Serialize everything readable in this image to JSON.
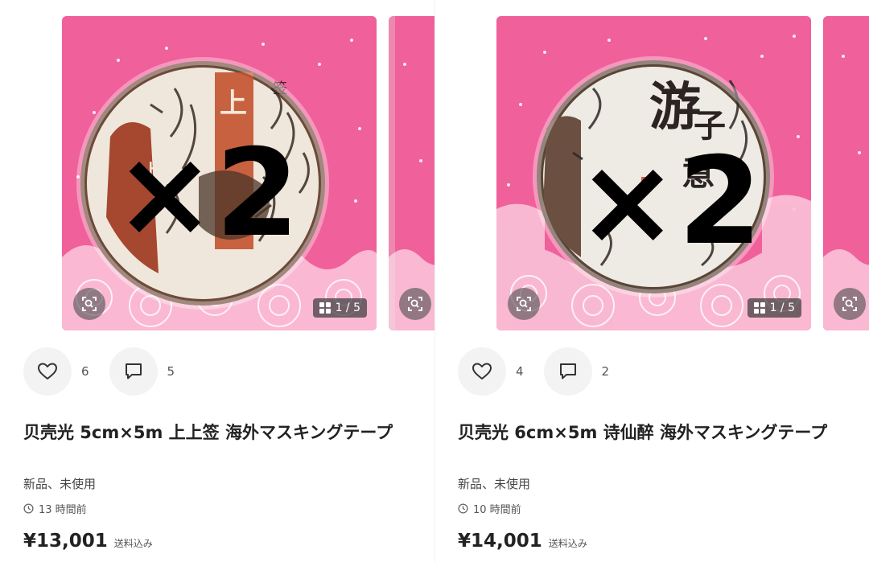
{
  "listings": [
    {
      "title": "贝壳光 5cm×5m 上上签 海外マスキングテープ",
      "condition": "新品、未使用",
      "posted": "13 時間前",
      "price": "¥13,001",
      "shipping": "送料込み",
      "likes": "6",
      "comments": "5",
      "image_counter": "1 / 5",
      "overlay_text": "×2",
      "tape_chars": [
        "上",
        "上",
        "签"
      ],
      "icons": [
        "heart-icon",
        "comment-icon",
        "clock-icon",
        "lens-search-icon",
        "grid-icon"
      ]
    },
    {
      "title": "贝壳光 6cm×5m 诗仙醉 海外マスキングテープ",
      "condition": "新品、未使用",
      "posted": "10 時間前",
      "price": "¥14,001",
      "shipping": "送料込み",
      "likes": "4",
      "comments": "2",
      "image_counter": "1 / 5",
      "overlay_text": "×2",
      "tape_chars": [
        "游",
        "子",
        "意"
      ],
      "icons": [
        "heart-icon",
        "comment-icon",
        "clock-icon",
        "lens-search-icon",
        "grid-icon"
      ]
    }
  ],
  "colors": {
    "photo_background": "#f0609a",
    "counter_badge": "#3c3c3c",
    "action_circle": "#f3f3f3",
    "text_primary": "#222222"
  }
}
